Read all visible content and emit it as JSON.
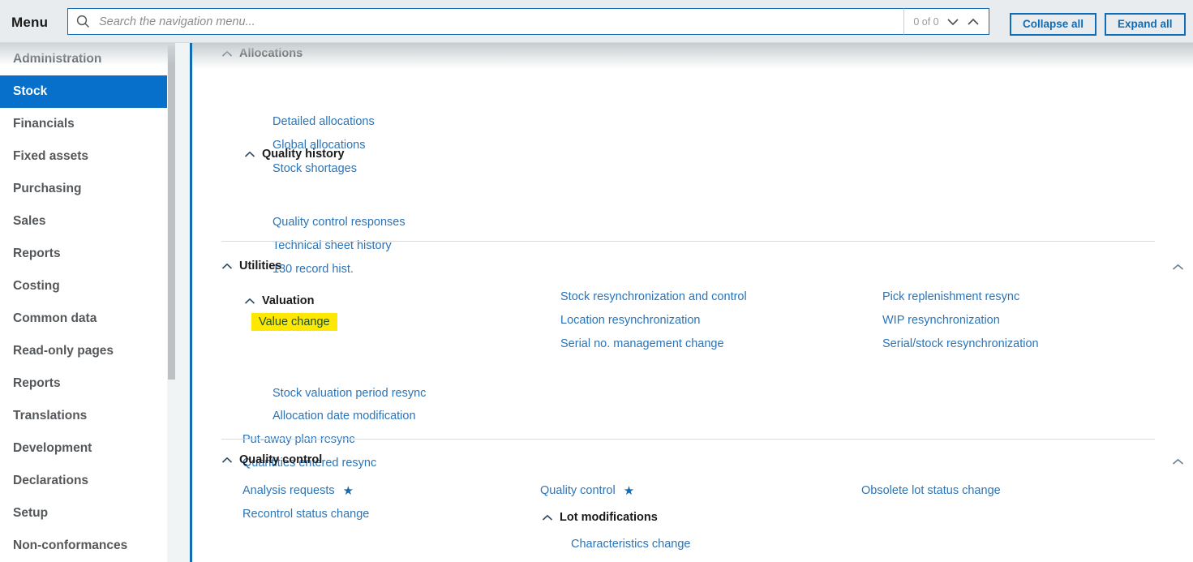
{
  "header": {
    "menu_label": "Menu",
    "search": {
      "placeholder": "Search the navigation menu...",
      "value": ""
    },
    "match_count": "0 of 0",
    "prev_icon": "chevron-down-icon",
    "next_icon": "chevron-up-icon",
    "collapse_all_label": "Collapse all",
    "expand_all_label": "Expand all",
    "accent_color": "#0f6cb6",
    "background_color": "#e8ecee"
  },
  "sidebar": {
    "items": [
      {
        "label": "Administration",
        "active": false
      },
      {
        "label": "Stock",
        "active": true
      },
      {
        "label": "Financials",
        "active": false
      },
      {
        "label": "Fixed assets",
        "active": false
      },
      {
        "label": "Purchasing",
        "active": false
      },
      {
        "label": "Sales",
        "active": false
      },
      {
        "label": "Reports",
        "active": false
      },
      {
        "label": "Costing",
        "active": false
      },
      {
        "label": "Common data",
        "active": false
      },
      {
        "label": "Read-only pages",
        "active": false
      },
      {
        "label": "Reports",
        "active": false
      },
      {
        "label": "Translations",
        "active": false
      },
      {
        "label": "Development",
        "active": false
      },
      {
        "label": "Declarations",
        "active": false
      },
      {
        "label": "Setup",
        "active": false
      },
      {
        "label": "Non-conformances",
        "active": false
      }
    ],
    "active_color": "#0670ca"
  },
  "content": {
    "groups": {
      "allocations": {
        "title": "Allocations",
        "items": [
          "Detailed allocations",
          "Global allocations",
          "Stock shortages"
        ]
      },
      "quality_history": {
        "title": "Quality history",
        "items": [
          "Quality control responses",
          "Technical sheet history",
          "130 record hist."
        ]
      },
      "utilities": {
        "title": "Utilities",
        "valuation": {
          "title": "Valuation",
          "items": [
            {
              "label": "Value change",
              "highlighted": true
            },
            {
              "label": "Stock valuation period resync",
              "highlighted": false
            },
            {
              "label": "Allocation date modification",
              "highlighted": false
            }
          ]
        },
        "col1_extra": [
          "Put-away plan resync",
          "Quantities entered resync"
        ],
        "col2": [
          "Stock resynchronization and control",
          "Location resynchronization",
          "Serial no. management change"
        ],
        "col3": [
          "Pick replenishment resync",
          "WIP resynchronization",
          "Serial/stock resynchronization"
        ]
      },
      "quality_control": {
        "title": "Quality control",
        "col1": [
          {
            "label": "Analysis requests",
            "starred": true
          },
          {
            "label": "Recontrol status change",
            "starred": false
          }
        ],
        "col2_top": {
          "label": "Quality control",
          "starred": true
        },
        "col2_group": {
          "title": "Lot modifications",
          "items": [
            "Characteristics change"
          ]
        },
        "col3": [
          "Obsolete lot status change"
        ]
      }
    },
    "highlight_color": "#ffe800",
    "link_color": "#2b74b8"
  }
}
